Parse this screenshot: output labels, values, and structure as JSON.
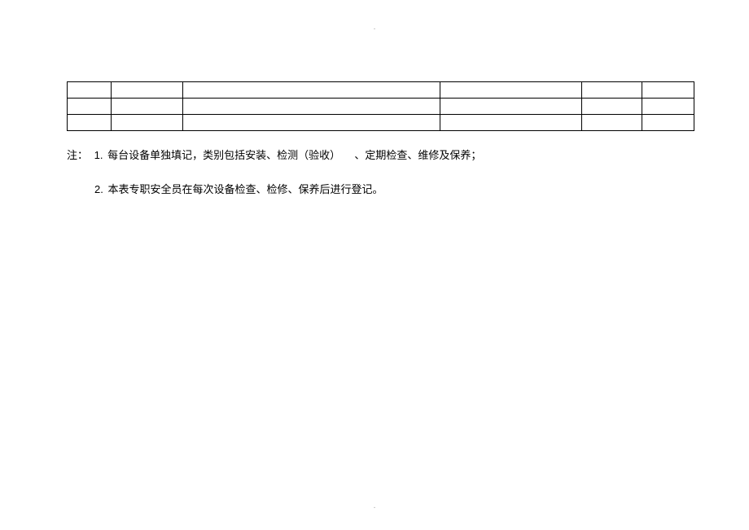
{
  "pageMarkTop": ".",
  "pageMarkBottom": ".",
  "notes": {
    "prefix": "注：",
    "item1Num": "1.",
    "item1TextA": "每台设备单独填记，类别包括安装、检测（验收）",
    "item1TextB": "、定期检查、维修及保养；",
    "item2Num": "2.",
    "item2Text": "本表专职安全员在每次设备检查、检修、保养后进行登记。"
  }
}
